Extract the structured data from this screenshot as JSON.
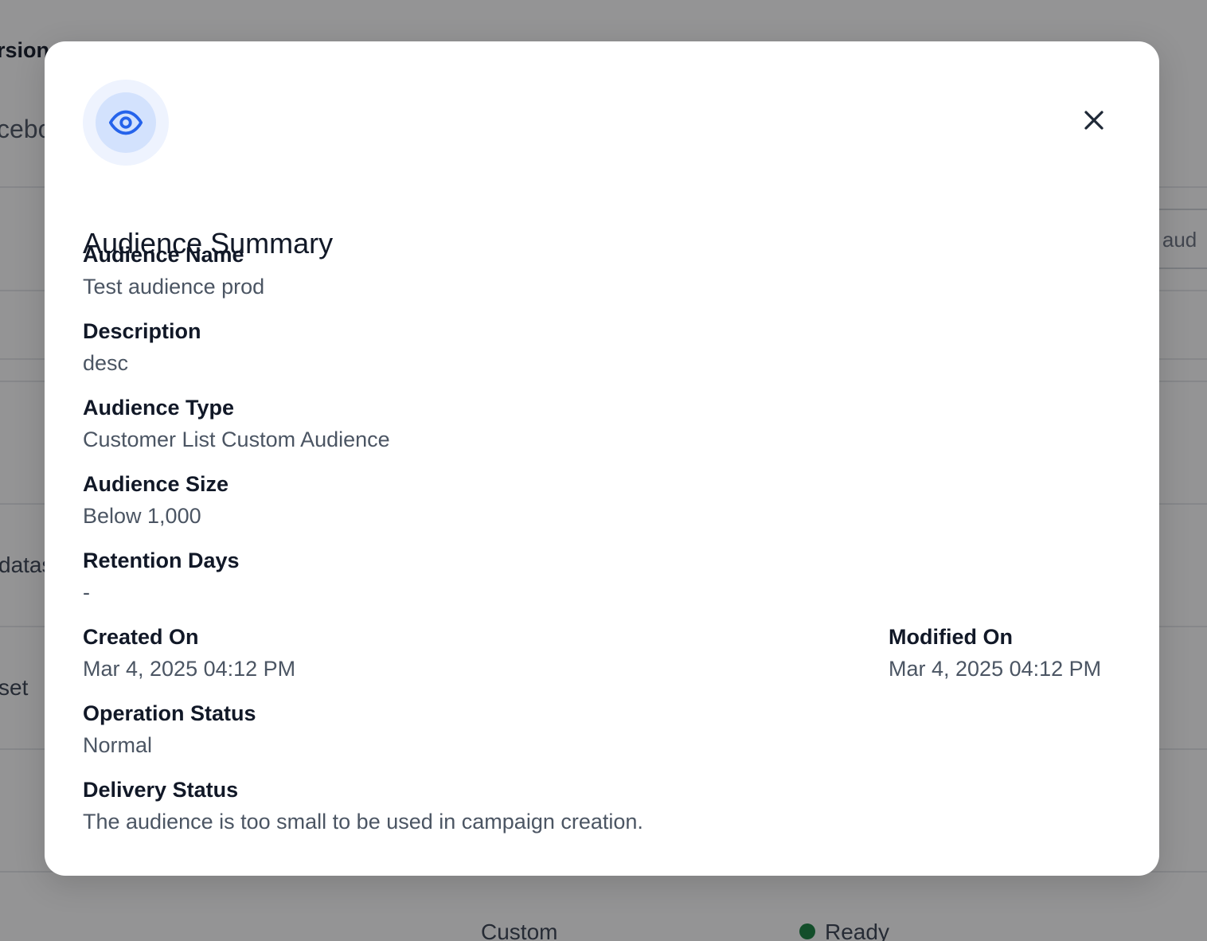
{
  "background": {
    "fragments": [
      "rsions",
      "cebo",
      "r aud",
      "datas",
      "set",
      "Custom",
      "Ready"
    ]
  },
  "modal": {
    "title": "Audience Summary",
    "header_icon": "eye-icon",
    "close_icon": "close-icon",
    "accent_color": "#2563eb",
    "fields": {
      "audience_name": {
        "label": "Audience Name",
        "value": "Test audience prod"
      },
      "description": {
        "label": "Description",
        "value": "desc"
      },
      "audience_type": {
        "label": "Audience Type",
        "value": "Customer List Custom Audience"
      },
      "audience_size": {
        "label": "Audience Size",
        "value": "Below 1,000"
      },
      "retention_days": {
        "label": "Retention Days",
        "value": "-"
      },
      "created_on": {
        "label": "Created On",
        "value": "Mar 4, 2025 04:12 PM"
      },
      "modified_on": {
        "label": "Modified On",
        "value": "Mar 4, 2025 04:12 PM"
      },
      "operation_status": {
        "label": "Operation Status",
        "value": "Normal"
      },
      "delivery_status": {
        "label": "Delivery Status",
        "value": "The audience is too small to be used in campaign creation."
      }
    }
  }
}
